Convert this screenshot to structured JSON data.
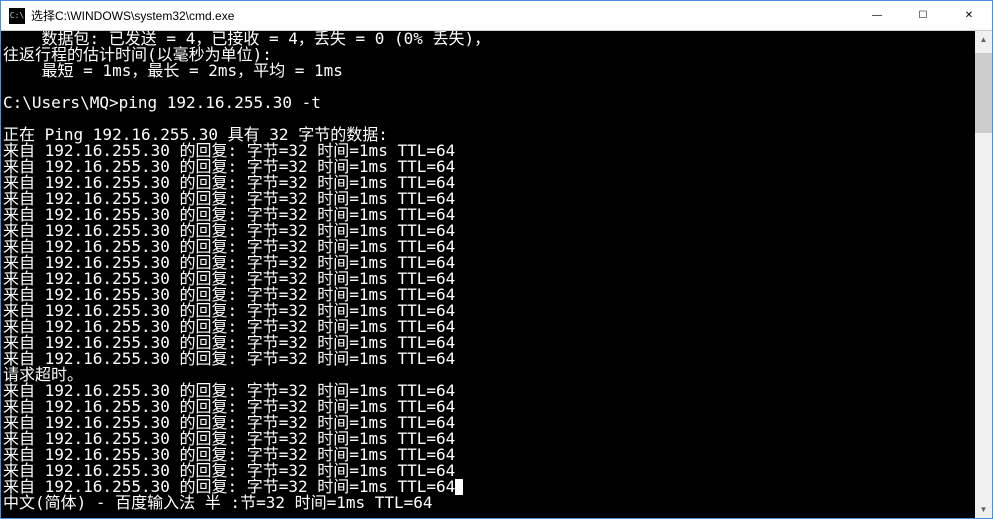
{
  "titlebar": {
    "icon_label": "C:\\",
    "title": "选择C:\\WINDOWS\\system32\\cmd.exe",
    "minimize": "—",
    "maximize": "☐",
    "close": "✕"
  },
  "terminal": {
    "lines": [
      "    数据包: 已发送 = 4，已接收 = 4，丢失 = 0 (0% 丢失)，",
      "往返行程的估计时间(以毫秒为单位):",
      "    最短 = 1ms，最长 = 2ms，平均 = 1ms",
      "",
      "C:\\Users\\MQ>ping 192.16.255.30 -t",
      "",
      "正在 Ping 192.16.255.30 具有 32 字节的数据:",
      "来自 192.16.255.30 的回复: 字节=32 时间=1ms TTL=64",
      "来自 192.16.255.30 的回复: 字节=32 时间=1ms TTL=64",
      "来自 192.16.255.30 的回复: 字节=32 时间=1ms TTL=64",
      "来自 192.16.255.30 的回复: 字节=32 时间=1ms TTL=64",
      "来自 192.16.255.30 的回复: 字节=32 时间=1ms TTL=64",
      "来自 192.16.255.30 的回复: 字节=32 时间=1ms TTL=64",
      "来自 192.16.255.30 的回复: 字节=32 时间=1ms TTL=64",
      "来自 192.16.255.30 的回复: 字节=32 时间=1ms TTL=64",
      "来自 192.16.255.30 的回复: 字节=32 时间=1ms TTL=64",
      "来自 192.16.255.30 的回复: 字节=32 时间=1ms TTL=64",
      "来自 192.16.255.30 的回复: 字节=32 时间=1ms TTL=64",
      "来自 192.16.255.30 的回复: 字节=32 时间=1ms TTL=64",
      "来自 192.16.255.30 的回复: 字节=32 时间=1ms TTL=64",
      "来自 192.16.255.30 的回复: 字节=32 时间=1ms TTL=64",
      "请求超时。",
      "来自 192.16.255.30 的回复: 字节=32 时间=1ms TTL=64",
      "来自 192.16.255.30 的回复: 字节=32 时间=1ms TTL=64",
      "来自 192.16.255.30 的回复: 字节=32 时间=1ms TTL=64",
      "来自 192.16.255.30 的回复: 字节=32 时间=1ms TTL=64",
      "来自 192.16.255.30 的回复: 字节=32 时间=1ms TTL=64",
      "来自 192.16.255.30 的回复: 字节=32 时间=1ms TTL=64"
    ],
    "cursor_line": "来自 192.16.255.30 的回复: 字节=32 时间=1ms TTL=64",
    "ime_line": "中文(简体) - 百度输入法 半 :节=32 时间=1ms TTL=64"
  },
  "scrollbar": {
    "up": "▲",
    "down": "▼"
  }
}
